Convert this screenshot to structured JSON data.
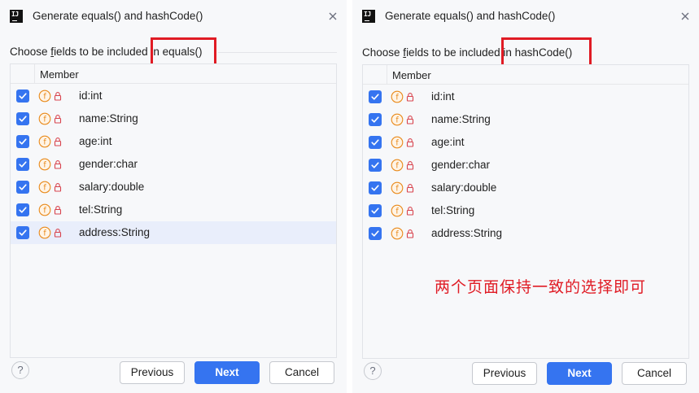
{
  "colors": {
    "accent": "#3574f0",
    "annotation_red": "#e01b24",
    "field_icon_orange": "#e98a1b",
    "lock_red": "#d8434d"
  },
  "dialogs": [
    {
      "title": "Generate equals() and hashCode()",
      "subtitle_pre": "Choose ",
      "subtitle_mn": "f",
      "subtitle_mid": "ields to be included ",
      "subtitle_method": "in equals()",
      "column_header": "Member",
      "fields": [
        "id:int",
        "name:String",
        "age:int",
        "gender:char",
        "salary:double",
        "tel:String",
        "address:String"
      ],
      "selected_row": "address:String",
      "buttons": {
        "help": "?",
        "previous": "Previous",
        "next": "Next",
        "cancel": "Cancel"
      }
    },
    {
      "title": "Generate equals() and hashCode()",
      "subtitle_pre": "Choose ",
      "subtitle_mn": "f",
      "subtitle_mid": "ields to be included ",
      "subtitle_method": "in hashCode()",
      "column_header": "Member",
      "fields": [
        "id:int",
        "name:String",
        "age:int",
        "gender:char",
        "salary:double",
        "tel:String",
        "address:String"
      ],
      "buttons": {
        "help": "?",
        "previous": "Previous",
        "next": "Next",
        "cancel": "Cancel"
      }
    }
  ],
  "icons": {
    "app": "intellij-icon",
    "close": "close-icon",
    "checkbox": "checkbox-checked-icon",
    "field": "field-icon",
    "lock": "private-lock-icon",
    "help": "help-icon"
  },
  "annotation": "两个页面保持一致的选择即可"
}
